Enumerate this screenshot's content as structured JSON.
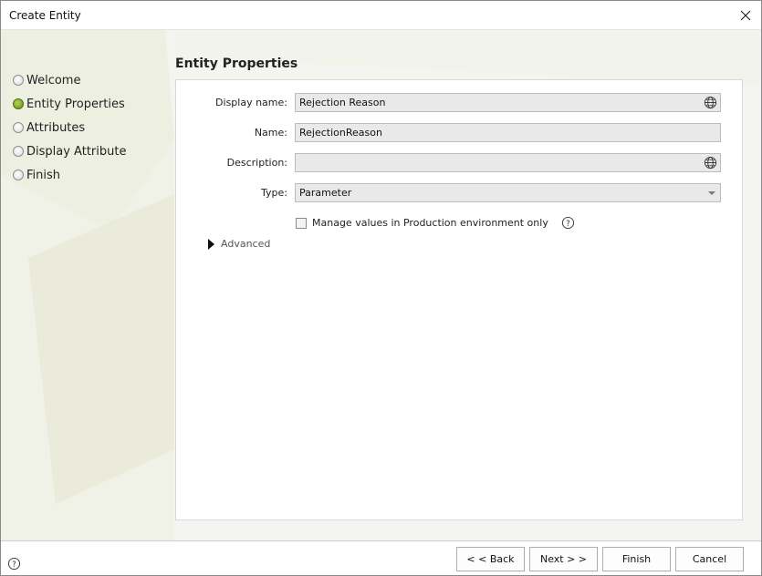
{
  "window": {
    "title": "Create Entity"
  },
  "wizard": {
    "steps": [
      {
        "label": "Welcome",
        "active": false
      },
      {
        "label": "Entity Properties",
        "active": true
      },
      {
        "label": "Attributes",
        "active": false
      },
      {
        "label": "Display Attribute",
        "active": false
      },
      {
        "label": "Finish",
        "active": false
      }
    ]
  },
  "section": {
    "title": "Entity Properties"
  },
  "form": {
    "display_name": {
      "label": "Display name:",
      "value": "Rejection Reason"
    },
    "name": {
      "label": "Name:",
      "value": "RejectionReason"
    },
    "description": {
      "label": "Description:",
      "value": ""
    },
    "type": {
      "label": "Type:",
      "value": "Parameter"
    },
    "manage_values": {
      "label": "Manage values in Production environment only",
      "checked": false
    },
    "advanced": {
      "label": "Advanced"
    }
  },
  "footer": {
    "back_label": "< < Back",
    "next_label": "Next > >",
    "finish_label": "Finish",
    "cancel_label": "Cancel"
  },
  "icons": {
    "close": "close-icon",
    "globe": "globe-icon",
    "help": "question-circle-icon",
    "expand": "triangle-right-icon",
    "dropdown": "chevron-down-icon"
  },
  "colors": {
    "active_step": "#6b9a1a",
    "field_bg": "#e9e9e9",
    "window_bg": "#f4f4f0"
  }
}
